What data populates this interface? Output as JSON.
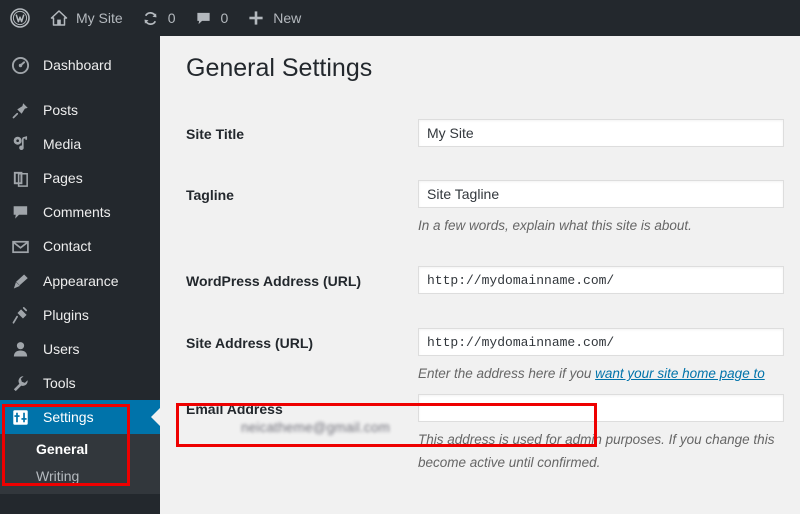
{
  "adminbar": {
    "logo_icon": "wordpress-logo-icon",
    "site_name": "My Site",
    "site_icon": "home-icon",
    "updates_icon": "updates-icon",
    "updates_count": "0",
    "comments_icon": "comment-bubble-icon",
    "comments_count": "0",
    "new_icon": "plus-icon",
    "new_label": "New"
  },
  "sidebar": {
    "items": [
      {
        "label": "Dashboard",
        "icon": "dashboard-icon",
        "current": false
      },
      {
        "label": "Posts",
        "icon": "pin-icon",
        "current": false
      },
      {
        "label": "Media",
        "icon": "media-icon",
        "current": false
      },
      {
        "label": "Pages",
        "icon": "pages-icon",
        "current": false
      },
      {
        "label": "Comments",
        "icon": "comment-bubble-icon",
        "current": false
      },
      {
        "label": "Contact",
        "icon": "envelope-icon",
        "current": false
      },
      {
        "label": "Appearance",
        "icon": "paintbrush-icon",
        "current": false
      },
      {
        "label": "Plugins",
        "icon": "plug-icon",
        "current": false
      },
      {
        "label": "Users",
        "icon": "user-icon",
        "current": false
      },
      {
        "label": "Tools",
        "icon": "wrench-icon",
        "current": false
      },
      {
        "label": "Settings",
        "icon": "settings-sliders-icon",
        "current": true
      }
    ],
    "submenu": [
      {
        "label": "General",
        "current": true
      },
      {
        "label": "Writing",
        "current": false
      }
    ],
    "active_color": "#0073aa",
    "background_color": "#23282d",
    "submenu_background_color": "#32373c"
  },
  "main": {
    "page_title": "General Settings",
    "fields": [
      {
        "label": "Site Title",
        "value": "My Site",
        "mono": false,
        "description": ""
      },
      {
        "label": "Tagline",
        "value": "Site Tagline",
        "mono": false,
        "description": "In a few words, explain what this site is about."
      },
      {
        "label": "WordPress Address (URL)",
        "value": "http://mydomainname.com/",
        "mono": true,
        "description": ""
      },
      {
        "label": "Site Address (URL)",
        "value": "http://mydomainname.com/",
        "mono": true,
        "description_prefix": "Enter the address here if you ",
        "description_link": "want your site home page to "
      },
      {
        "label": "Email Address",
        "value": "neicatheme@gmail.com",
        "value_obfuscated": true,
        "mono": false,
        "description_line1": "This address is used for admin purposes. If you change this",
        "description_line2": "become active until confirmed."
      }
    ]
  },
  "annotations": {
    "color": "#ee0000",
    "boxes": [
      {
        "name": "settings-menu-highlight"
      },
      {
        "name": "email-address-highlight"
      }
    ]
  }
}
